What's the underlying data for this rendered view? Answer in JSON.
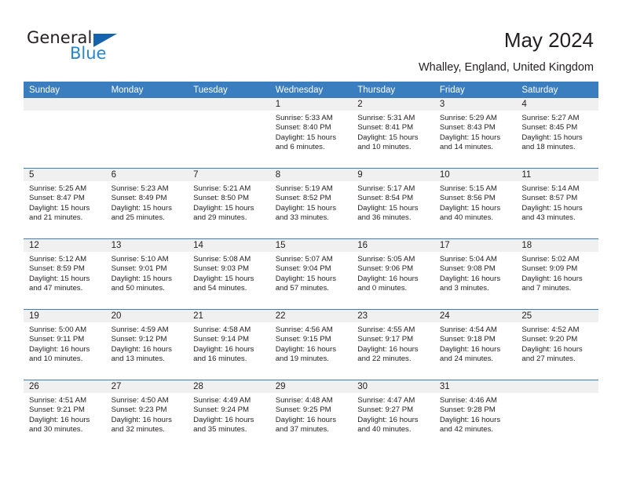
{
  "brand": {
    "name_part1": "General",
    "name_part2": "Blue",
    "accent_color": "#2585d3",
    "triangle_color": "#1463ad"
  },
  "header": {
    "title": "May 2024",
    "subtitle": "Whalley, England, United Kingdom"
  },
  "theme": {
    "header_row_color": "#3a7ebf",
    "daynum_background": "#f0f0f0",
    "text_color": "#231f20"
  },
  "weekday_headers": [
    "Sunday",
    "Monday",
    "Tuesday",
    "Wednesday",
    "Thursday",
    "Friday",
    "Saturday"
  ],
  "labels": {
    "sunrise_prefix": "Sunrise:",
    "sunset_prefix": "Sunset:",
    "daylight_prefix": "Daylight:"
  },
  "weeks": [
    [
      {
        "day": "",
        "empty": true
      },
      {
        "day": "",
        "empty": true
      },
      {
        "day": "",
        "empty": true
      },
      {
        "day": "1",
        "sunrise": "Sunrise: 5:33 AM",
        "sunset": "Sunset: 8:40 PM",
        "daylight": "Daylight: 15 hours and 6 minutes."
      },
      {
        "day": "2",
        "sunrise": "Sunrise: 5:31 AM",
        "sunset": "Sunset: 8:41 PM",
        "daylight": "Daylight: 15 hours and 10 minutes."
      },
      {
        "day": "3",
        "sunrise": "Sunrise: 5:29 AM",
        "sunset": "Sunset: 8:43 PM",
        "daylight": "Daylight: 15 hours and 14 minutes."
      },
      {
        "day": "4",
        "sunrise": "Sunrise: 5:27 AM",
        "sunset": "Sunset: 8:45 PM",
        "daylight": "Daylight: 15 hours and 18 minutes."
      }
    ],
    [
      {
        "day": "5",
        "sunrise": "Sunrise: 5:25 AM",
        "sunset": "Sunset: 8:47 PM",
        "daylight": "Daylight: 15 hours and 21 minutes."
      },
      {
        "day": "6",
        "sunrise": "Sunrise: 5:23 AM",
        "sunset": "Sunset: 8:49 PM",
        "daylight": "Daylight: 15 hours and 25 minutes."
      },
      {
        "day": "7",
        "sunrise": "Sunrise: 5:21 AM",
        "sunset": "Sunset: 8:50 PM",
        "daylight": "Daylight: 15 hours and 29 minutes."
      },
      {
        "day": "8",
        "sunrise": "Sunrise: 5:19 AM",
        "sunset": "Sunset: 8:52 PM",
        "daylight": "Daylight: 15 hours and 33 minutes."
      },
      {
        "day": "9",
        "sunrise": "Sunrise: 5:17 AM",
        "sunset": "Sunset: 8:54 PM",
        "daylight": "Daylight: 15 hours and 36 minutes."
      },
      {
        "day": "10",
        "sunrise": "Sunrise: 5:15 AM",
        "sunset": "Sunset: 8:56 PM",
        "daylight": "Daylight: 15 hours and 40 minutes."
      },
      {
        "day": "11",
        "sunrise": "Sunrise: 5:14 AM",
        "sunset": "Sunset: 8:57 PM",
        "daylight": "Daylight: 15 hours and 43 minutes."
      }
    ],
    [
      {
        "day": "12",
        "sunrise": "Sunrise: 5:12 AM",
        "sunset": "Sunset: 8:59 PM",
        "daylight": "Daylight: 15 hours and 47 minutes."
      },
      {
        "day": "13",
        "sunrise": "Sunrise: 5:10 AM",
        "sunset": "Sunset: 9:01 PM",
        "daylight": "Daylight: 15 hours and 50 minutes."
      },
      {
        "day": "14",
        "sunrise": "Sunrise: 5:08 AM",
        "sunset": "Sunset: 9:03 PM",
        "daylight": "Daylight: 15 hours and 54 minutes."
      },
      {
        "day": "15",
        "sunrise": "Sunrise: 5:07 AM",
        "sunset": "Sunset: 9:04 PM",
        "daylight": "Daylight: 15 hours and 57 minutes."
      },
      {
        "day": "16",
        "sunrise": "Sunrise: 5:05 AM",
        "sunset": "Sunset: 9:06 PM",
        "daylight": "Daylight: 16 hours and 0 minutes."
      },
      {
        "day": "17",
        "sunrise": "Sunrise: 5:04 AM",
        "sunset": "Sunset: 9:08 PM",
        "daylight": "Daylight: 16 hours and 3 minutes."
      },
      {
        "day": "18",
        "sunrise": "Sunrise: 5:02 AM",
        "sunset": "Sunset: 9:09 PM",
        "daylight": "Daylight: 16 hours and 7 minutes."
      }
    ],
    [
      {
        "day": "19",
        "sunrise": "Sunrise: 5:00 AM",
        "sunset": "Sunset: 9:11 PM",
        "daylight": "Daylight: 16 hours and 10 minutes."
      },
      {
        "day": "20",
        "sunrise": "Sunrise: 4:59 AM",
        "sunset": "Sunset: 9:12 PM",
        "daylight": "Daylight: 16 hours and 13 minutes."
      },
      {
        "day": "21",
        "sunrise": "Sunrise: 4:58 AM",
        "sunset": "Sunset: 9:14 PM",
        "daylight": "Daylight: 16 hours and 16 minutes."
      },
      {
        "day": "22",
        "sunrise": "Sunrise: 4:56 AM",
        "sunset": "Sunset: 9:15 PM",
        "daylight": "Daylight: 16 hours and 19 minutes."
      },
      {
        "day": "23",
        "sunrise": "Sunrise: 4:55 AM",
        "sunset": "Sunset: 9:17 PM",
        "daylight": "Daylight: 16 hours and 22 minutes."
      },
      {
        "day": "24",
        "sunrise": "Sunrise: 4:54 AM",
        "sunset": "Sunset: 9:18 PM",
        "daylight": "Daylight: 16 hours and 24 minutes."
      },
      {
        "day": "25",
        "sunrise": "Sunrise: 4:52 AM",
        "sunset": "Sunset: 9:20 PM",
        "daylight": "Daylight: 16 hours and 27 minutes."
      }
    ],
    [
      {
        "day": "26",
        "sunrise": "Sunrise: 4:51 AM",
        "sunset": "Sunset: 9:21 PM",
        "daylight": "Daylight: 16 hours and 30 minutes."
      },
      {
        "day": "27",
        "sunrise": "Sunrise: 4:50 AM",
        "sunset": "Sunset: 9:23 PM",
        "daylight": "Daylight: 16 hours and 32 minutes."
      },
      {
        "day": "28",
        "sunrise": "Sunrise: 4:49 AM",
        "sunset": "Sunset: 9:24 PM",
        "daylight": "Daylight: 16 hours and 35 minutes."
      },
      {
        "day": "29",
        "sunrise": "Sunrise: 4:48 AM",
        "sunset": "Sunset: 9:25 PM",
        "daylight": "Daylight: 16 hours and 37 minutes."
      },
      {
        "day": "30",
        "sunrise": "Sunrise: 4:47 AM",
        "sunset": "Sunset: 9:27 PM",
        "daylight": "Daylight: 16 hours and 40 minutes."
      },
      {
        "day": "31",
        "sunrise": "Sunrise: 4:46 AM",
        "sunset": "Sunset: 9:28 PM",
        "daylight": "Daylight: 16 hours and 42 minutes."
      },
      {
        "day": "",
        "empty": true
      }
    ]
  ]
}
